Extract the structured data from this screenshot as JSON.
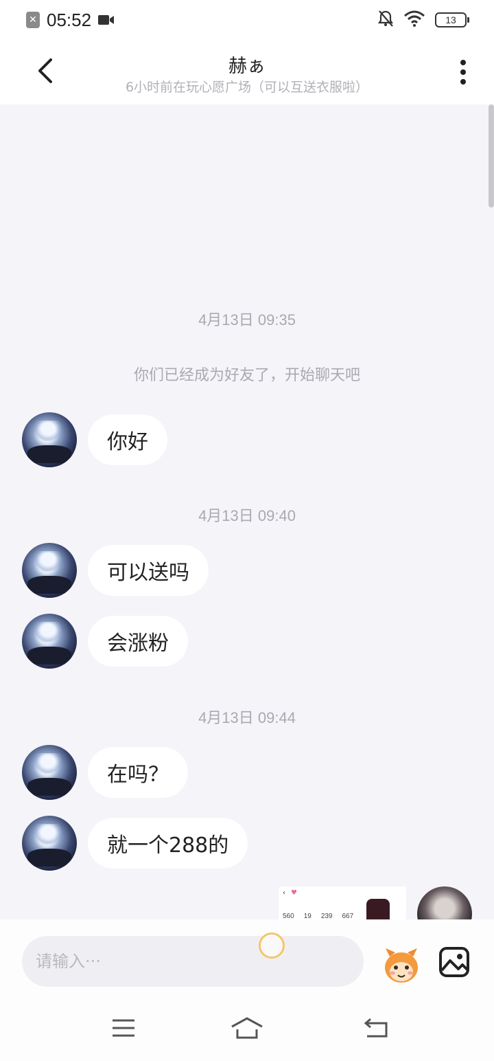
{
  "status_bar": {
    "time": "05:52",
    "battery": "13",
    "sim_icon": "sim-error-icon"
  },
  "header": {
    "title": "赫ぁ",
    "subtitle": "6小时前在玩心愿广场（可以互送衣服啦）"
  },
  "chat": {
    "items": [
      {
        "kind": "timestamp",
        "text": "4月13日 09:35"
      },
      {
        "kind": "system",
        "text": "你们已经成为好友了，开始聊天吧"
      },
      {
        "kind": "message",
        "text": "你好"
      },
      {
        "kind": "timestamp",
        "text": "4月13日 09:40"
      },
      {
        "kind": "message",
        "text": "可以送吗"
      },
      {
        "kind": "message",
        "text": "会涨粉"
      },
      {
        "kind": "timestamp",
        "text": "4月13日 09:44"
      },
      {
        "kind": "message",
        "text": "在吗？"
      },
      {
        "kind": "message",
        "text": "就一个288的"
      }
    ],
    "sent_preview": {
      "stats": [
        "560",
        "19",
        "239",
        "667"
      ]
    }
  },
  "input": {
    "placeholder": "请输入···"
  },
  "colors": {
    "background": "#f4f4f9",
    "bubble": "#ffffff",
    "muted_text": "#a9a9b0"
  }
}
